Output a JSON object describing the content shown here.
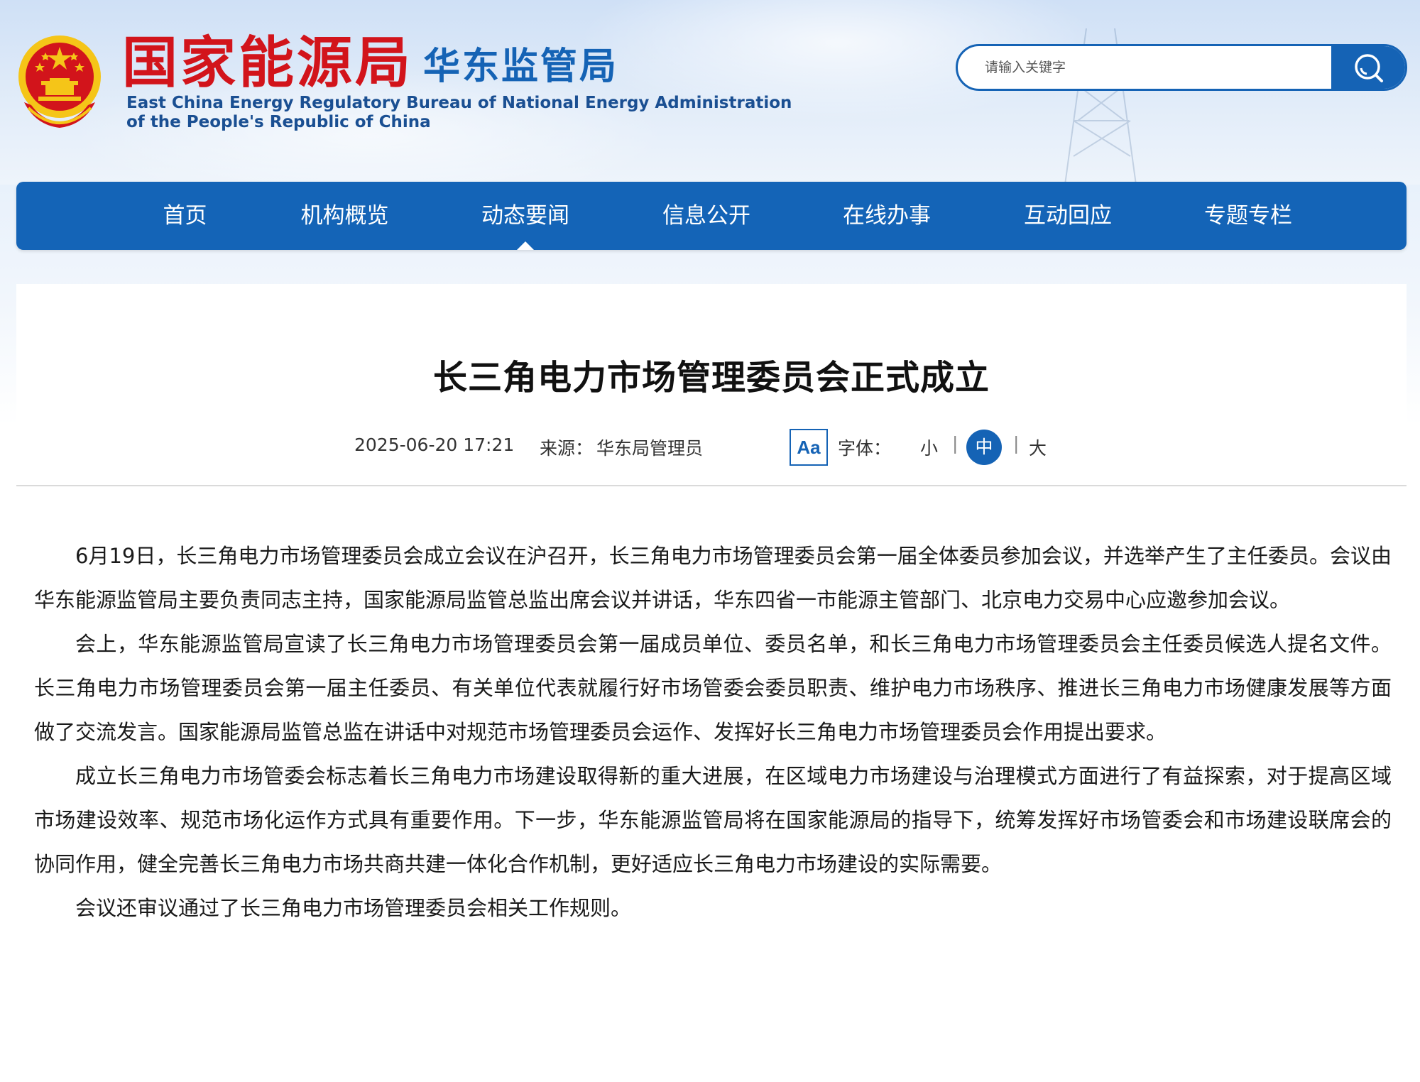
{
  "header": {
    "brand_cn": "国家能源局",
    "bureau_cn": "华东监管局",
    "brand_en_line1": "East China Energy Regulatory Bureau of National Energy Administration",
    "brand_en_line2": "of the People's Republic of China",
    "search": {
      "placeholder": "请输入关键字"
    }
  },
  "nav": {
    "items": [
      {
        "label": "首页"
      },
      {
        "label": "机构概览"
      },
      {
        "label": "动态要闻"
      },
      {
        "label": "信息公开"
      },
      {
        "label": "在线办事"
      },
      {
        "label": "互动回应"
      },
      {
        "label": "专题专栏"
      }
    ],
    "active": "动态要闻"
  },
  "article": {
    "title": "长三角电力市场管理委员会正式成立",
    "date": "2025-06-20 17:21",
    "source_label": "来源：",
    "source": "华东局管理员",
    "font_icon": "Aa",
    "font_label": "字体：",
    "font_sizes": {
      "small": "小",
      "medium": "中",
      "large": "大",
      "active": "中"
    },
    "separator": "|",
    "paragraphs": [
      "6月19日，长三角电力市场管理委员会成立会议在沪召开，长三角电力市场管理委员会第一届全体委员参加会议，并选举产生了主任委员。会议由华东能源监管局主要负责同志主持，国家能源局监管总监出席会议并讲话，华东四省一市能源主管部门、北京电力交易中心应邀参加会议。",
      "会上，华东能源监管局宣读了长三角电力市场管理委员会第一届成员单位、委员名单，和长三角电力市场管理委员会主任委员候选人提名文件。长三角电力市场管理委员会第一届主任委员、有关单位代表就履行好市场管委会委员职责、维护电力市场秩序、推进长三角电力市场健康发展等方面做了交流发言。国家能源局监管总监在讲话中对规范市场管理委员会运作、发挥好长三角电力市场管理委员会作用提出要求。",
      "成立长三角电力市场管委会标志着长三角电力市场建设取得新的重大进展，在区域电力市场建设与治理模式方面进行了有益探索，对于提高区域市场建设效率、规范市场化运作方式具有重要作用。下一步，华东能源监管局将在国家能源局的指导下，统筹发挥好市场管委会和市场建设联席会的协同作用，健全完善长三角电力市场共商共建一体化合作机制，更好适应长三角电力市场建设的实际需要。",
      "会议还审议通过了长三角电力市场管理委员会相关工作规则。"
    ]
  },
  "colors": {
    "brand_red": "#d2141b",
    "brand_blue": "#1563b5",
    "nav_blue": "#1464b7",
    "emblem_gold": "#f5c518"
  },
  "icons": [
    "national-emblem-icon",
    "power-tower-icon",
    "search-icon",
    "font-size-icon"
  ]
}
